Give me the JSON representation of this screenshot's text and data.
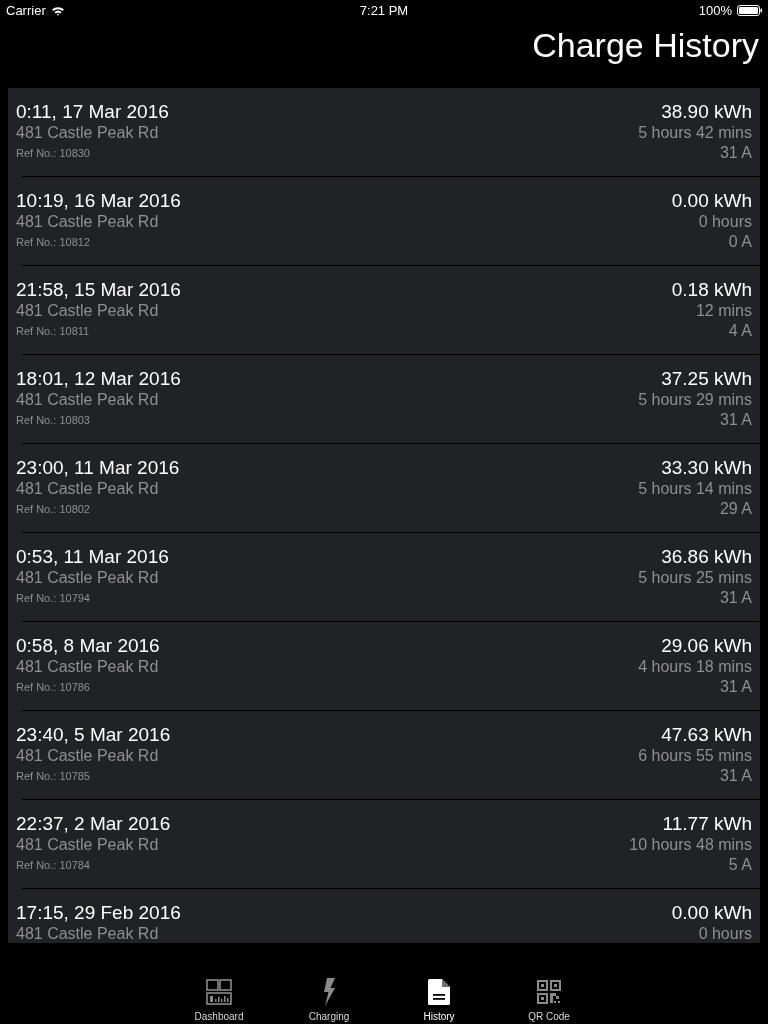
{
  "status_bar": {
    "carrier": "Carrier",
    "time": "7:21 PM",
    "battery": "100%"
  },
  "title": "Charge History",
  "sessions": [
    {
      "datetime": "0:11, 17 Mar 2016",
      "address": "481 Castle Peak Rd",
      "ref": "Ref No.: 10830",
      "energy": "38.90 kWh",
      "duration": "5 hours 42 mins",
      "current": "31 A"
    },
    {
      "datetime": "10:19, 16 Mar 2016",
      "address": "481 Castle Peak Rd",
      "ref": "Ref No.: 10812",
      "energy": "0.00 kWh",
      "duration": "0 hours",
      "current": "0 A"
    },
    {
      "datetime": "21:58, 15 Mar 2016",
      "address": "481 Castle Peak Rd",
      "ref": "Ref No.: 10811",
      "energy": "0.18 kWh",
      "duration": "12 mins",
      "current": "4 A"
    },
    {
      "datetime": "18:01, 12 Mar 2016",
      "address": "481 Castle Peak Rd",
      "ref": "Ref No.: 10803",
      "energy": "37.25 kWh",
      "duration": "5 hours 29 mins",
      "current": "31 A"
    },
    {
      "datetime": "23:00, 11 Mar 2016",
      "address": "481 Castle Peak Rd",
      "ref": "Ref No.: 10802",
      "energy": "33.30 kWh",
      "duration": "5 hours 14 mins",
      "current": "29 A"
    },
    {
      "datetime": "0:53, 11 Mar 2016",
      "address": "481 Castle Peak Rd",
      "ref": "Ref No.: 10794",
      "energy": "36.86 kWh",
      "duration": "5 hours 25 mins",
      "current": "31 A"
    },
    {
      "datetime": "0:58, 8 Mar 2016",
      "address": "481 Castle Peak Rd",
      "ref": "Ref No.: 10786",
      "energy": "29.06 kWh",
      "duration": "4 hours 18 mins",
      "current": "31 A"
    },
    {
      "datetime": "23:40, 5 Mar 2016",
      "address": "481 Castle Peak Rd",
      "ref": "Ref No.: 10785",
      "energy": "47.63 kWh",
      "duration": "6 hours 55 mins",
      "current": "31 A"
    },
    {
      "datetime": "22:37, 2 Mar 2016",
      "address": "481 Castle Peak Rd",
      "ref": "Ref No.: 10784",
      "energy": "11.77 kWh",
      "duration": "10 hours 48 mins",
      "current": "5 A"
    },
    {
      "datetime": "17:15, 29 Feb 2016",
      "address": "481 Castle Peak Rd",
      "energy": "0.00 kWh",
      "duration": "0 hours"
    }
  ],
  "tabs": [
    {
      "label": "Dashboard",
      "kind": "dashboard",
      "selected": false
    },
    {
      "label": "Charging",
      "kind": "charging",
      "selected": false
    },
    {
      "label": "History",
      "kind": "history",
      "selected": true
    },
    {
      "label": "QR Code",
      "kind": "qrcode",
      "selected": false
    }
  ]
}
